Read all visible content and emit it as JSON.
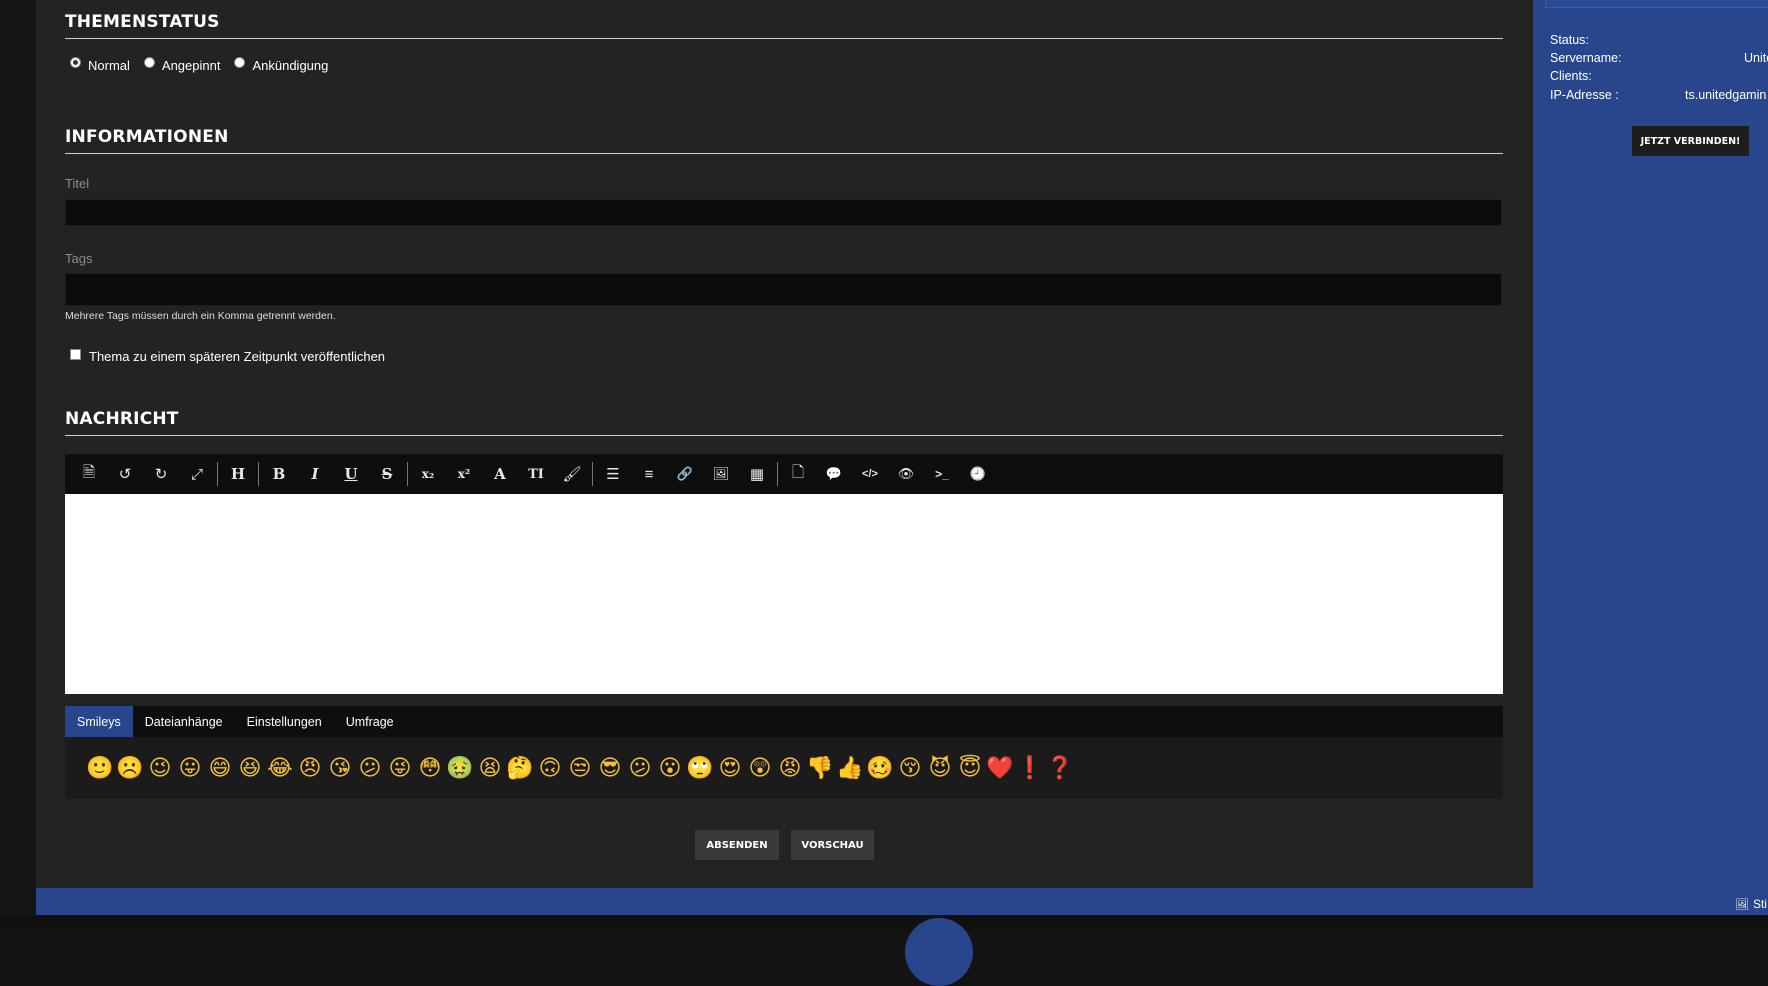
{
  "sections": {
    "status_title": "THEMENSTATUS",
    "info_title": "INFORMATIONEN",
    "message_title": "NACHRICHT"
  },
  "thread_status": {
    "options": [
      "Normal",
      "Angepinnt",
      "Ankündigung"
    ],
    "selected": "Normal"
  },
  "form": {
    "title_label": "Titel",
    "title_value": "",
    "tags_label": "Tags",
    "tags_value": "",
    "tags_hint": "Mehrere Tags müssen durch ein Komma getrennt werden.",
    "schedule_label": "Thema zu einem späteren Zeitpunkt veröffentlichen",
    "schedule_checked": false
  },
  "toolbar": {
    "groups": [
      [
        "source-icon",
        "undo-icon",
        "redo-icon",
        "fullscreen-icon"
      ],
      [
        "heading-icon",
        "bold-icon",
        "italic-icon",
        "underline-icon",
        "strikethrough-icon"
      ],
      [
        "subscript-icon",
        "superscript-icon",
        "font-icon",
        "font-size-icon",
        "color-brush-icon"
      ],
      [
        "list-icon",
        "align-icon",
        "link-icon",
        "image-icon",
        "table-icon"
      ],
      [
        "page-icon",
        "quote-icon",
        "code-icon",
        "spoiler-icon",
        "terminal-icon",
        "timestamp-icon"
      ]
    ],
    "glyphs": {
      "source-icon": "🗎",
      "undo-icon": "↺",
      "redo-icon": "↻",
      "fullscreen-icon": "⤢",
      "heading-icon": "H",
      "bold-icon": "B",
      "italic-icon": "I",
      "underline-icon": "U",
      "strikethrough-icon": "S",
      "subscript-icon": "x₂",
      "superscript-icon": "x²",
      "font-icon": "A",
      "font-size-icon": "TI",
      "color-brush-icon": "🖌",
      "list-icon": "☰",
      "align-icon": "≡",
      "link-icon": "🔗",
      "image-icon": "🖼",
      "table-icon": "▦",
      "page-icon": "🗋",
      "quote-icon": "💬",
      "code-icon": "</>",
      "spoiler-icon": "👁",
      "terminal-icon": ">_",
      "timestamp-icon": "🕘"
    }
  },
  "tabs": {
    "items": [
      "Smileys",
      "Dateianhänge",
      "Einstellungen",
      "Umfrage"
    ],
    "active": "Smileys"
  },
  "smileys": [
    "🙂",
    "☹️",
    "😉",
    "😛",
    "😄",
    "😆",
    "😂",
    "😠",
    "😘",
    "😕",
    "😜",
    "😳",
    "🤢",
    "😫",
    "🤔",
    "🙃",
    "😒",
    "😎",
    "😕",
    "😮",
    "🙄",
    "😍",
    "😲",
    "😡",
    "👎",
    "👍",
    "🥴",
    "😚",
    "😈",
    "😇",
    "❤️",
    "❗",
    "❓"
  ],
  "buttons": {
    "submit": "ABSENDEN",
    "preview": "VORSCHAU"
  },
  "teamspeak": {
    "status_label": "Status:",
    "status_value": "",
    "servername_label": "Servername:",
    "servername_value": "Unite",
    "clients_label": "Clients:",
    "clients_value": "",
    "ip_label": "IP-Adresse :",
    "ip_value": "ts.unitedgamin",
    "connect_button": "JETZT VERBINDEN!"
  },
  "footer": {
    "style_link": "Sti"
  },
  "colors": {
    "accent_blue": "#29468c",
    "panel_dark": "#232323",
    "input_dark": "#0b0b0b"
  }
}
